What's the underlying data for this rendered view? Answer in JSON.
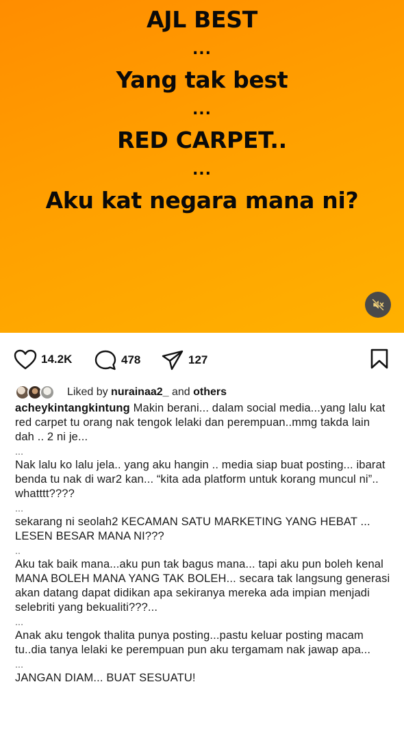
{
  "post": {
    "media_lines": [
      "AJL BEST",
      "...",
      "Yang tak best",
      "...",
      "RED CARPET..",
      "...",
      "Aku kat negara mana ni?"
    ],
    "media_gradient": [
      "#ff8d00",
      "#ffb100"
    ]
  },
  "actions": {
    "likes": "14.2K",
    "comments": "478",
    "shares": "127"
  },
  "liked_by": {
    "prefix": "Liked by ",
    "user": "nurainaa2_",
    "middle": " and ",
    "others": "others"
  },
  "caption": {
    "username": "acheykintangkintung",
    "first": " Makin berani... dalam social media...yang lalu kat red carpet tu orang nak tengok lelaki dan perempuan..mmg takda lain dah .. 2 ni je...",
    "sep1": "...",
    "p2": "Nak lalu ko lalu jela.. yang aku hangin .. media siap buat posting... ibarat benda tu nak di war2 kan... “kita ada platform untuk korang muncul ni”.. whatttt????",
    "sep2": "...",
    "p3": "sekarang ni seolah2 KECAMAN SATU MARKETING YANG HEBAT ... LESEN BESAR MANA NI???",
    "sep3": "..",
    "p4": "Aku tak baik mana...aku pun tak bagus mana... tapi aku pun boleh kenal MANA BOLEH MANA YANG TAK BOLEH... secara tak langsung generasi akan datang dapat didikan apa sekiranya mereka ada impian menjadi selebriti yang bekualiti???...",
    "sep4": "...",
    "p5": "Anak aku tengok thalita punya posting...pastu keluar posting macam tu..dia tanya lelaki ke perempuan pun aku tergamam nak jawap apa...",
    "sep5": "...",
    "p6": "JANGAN DIAM... BUAT SESUATU!"
  },
  "icons": {
    "mute": "speaker-muted-icon",
    "like": "heart-icon",
    "comment": "comment-bubble-icon",
    "share": "paper-plane-icon",
    "save": "bookmark-icon"
  }
}
